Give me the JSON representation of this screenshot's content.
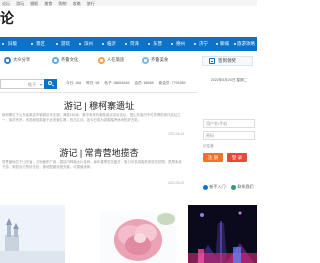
{
  "topbar": {
    "links": [
      "论坛",
      "游玩",
      "摄影",
      "美食",
      "购物",
      "攻略",
      "旅行"
    ]
  },
  "logo": {
    "text": "论坛"
  },
  "nav": {
    "items": [
      "旧版",
      "景区",
      "游玩",
      "滨州",
      "临沂",
      "菏泽",
      "东营",
      "德州",
      "济宁",
      "聊城",
      "旅游攻略"
    ],
    "bg": "#0d72c9"
  },
  "quicklinks": [
    {
      "label": "大众分享",
      "color": "#2f7fd0"
    },
    {
      "label": "齐鲁文化",
      "color": "#5aa8e6"
    },
    {
      "label": "人在旅途",
      "color": "#f2a33a"
    },
    {
      "label": "齐鲁美食",
      "color": "#7ab7e6"
    }
  ],
  "sign": {
    "label": "签到领奖"
  },
  "search": {
    "placeholder": "帖子",
    "chevron": "▾"
  },
  "stats": [
    "今日: 168",
    "昨日: 98",
    "帖子: 98654546",
    "会员: 88989",
    "新会员: 7791989"
  ],
  "date_line": "2022年5月24日 星期二",
  "articles": [
    {
      "title": "游记 | 穆柯寨遗址",
      "body": "穆柯寨位于山东省莱芜市钢城区辛庄镇，海拔280米，寨中有宋代穆桂英点将台遗址，是山东省内不可多得的宋代遗址之一，保存完好，传说穆桂英曾于此安营扎寨，抗击辽兵，如今已成为游客踏青休闲的好去处。",
      "time": "2022-05-24"
    },
    {
      "title": "游记 | 常青营地揽杏",
      "body": "常青营地位于山东省，占地面积广阔，园区内种植大片杏树，每年春季杏花盛开，吸引众多游客前来赏花拍照，是周末亲子游、家庭出行的好去处，营地配套设施完善，可露营烧烤。",
      "time": "2022-05-23"
    }
  ],
  "login": {
    "username_placeholder": "用户名/手机",
    "password_placeholder": "密码",
    "remember": "记住我",
    "login_label": "注 册",
    "register_label": "登 录"
  },
  "help": {
    "new_user": "新手入门",
    "contact": "联系我们"
  }
}
